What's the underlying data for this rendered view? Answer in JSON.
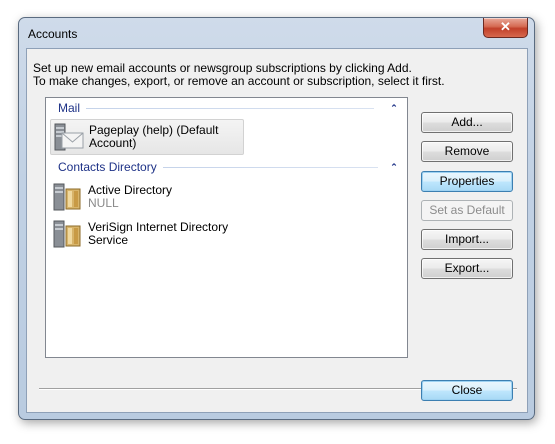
{
  "window": {
    "title": "Accounts",
    "close_glyph": "✕"
  },
  "description": {
    "line1": "Set up new email accounts or newsgroup subscriptions by clicking Add.",
    "line2": "To make changes, export, or remove an account or subscription, select it first."
  },
  "groups": [
    {
      "header": "Mail",
      "items": [
        {
          "name_line1": "Pageplay (help) (Default",
          "name_line2": "Account)",
          "icon": "mail-envelope-icon"
        }
      ]
    },
    {
      "header": "Contacts Directory",
      "items": [
        {
          "name_line1": "Active Directory",
          "name_line2": "NULL",
          "icon": "directory-server-icon"
        },
        {
          "name_line1": "VeriSign Internet Directory",
          "name_line2": "Service",
          "icon": "directory-server-icon"
        }
      ]
    }
  ],
  "buttons": {
    "add": "Add...",
    "remove": "Remove",
    "properties": "Properties",
    "set_default": "Set as Default",
    "import": "Import...",
    "export": "Export...",
    "close": "Close"
  },
  "colors": {
    "group_header": "#1e3287",
    "disabled_text": "#8c8c8c"
  }
}
